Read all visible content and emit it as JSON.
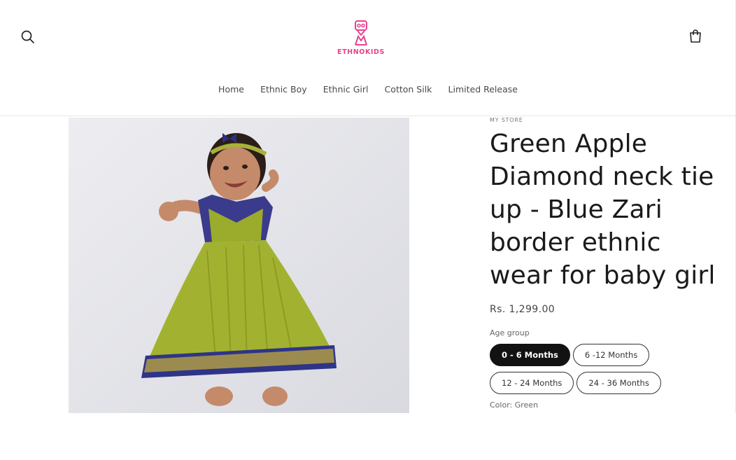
{
  "header": {
    "logo_text": "ETHNOKIDS",
    "search_icon": "search-icon",
    "cart_icon": "cart-icon",
    "brand_color": "#e8418f"
  },
  "nav": {
    "items": [
      {
        "label": "Home"
      },
      {
        "label": "Ethnic Boy"
      },
      {
        "label": "Ethnic Girl"
      },
      {
        "label": "Cotton Silk"
      },
      {
        "label": "Limited Release"
      }
    ]
  },
  "product": {
    "vendor": "MY STORE",
    "title": "Green Apple Diamond neck tie up - Blue Zari border ethnic wear for baby girl",
    "price": "Rs. 1,299.00",
    "age_group_label": "Age group",
    "age_options": [
      {
        "label": "0 - 6 Months",
        "selected": true
      },
      {
        "label": "6 -12 Months",
        "selected": false
      },
      {
        "label": "12 - 24 Months",
        "selected": false
      },
      {
        "label": "24 - 36 Months",
        "selected": false
      }
    ],
    "color_label": "Color: Green"
  }
}
